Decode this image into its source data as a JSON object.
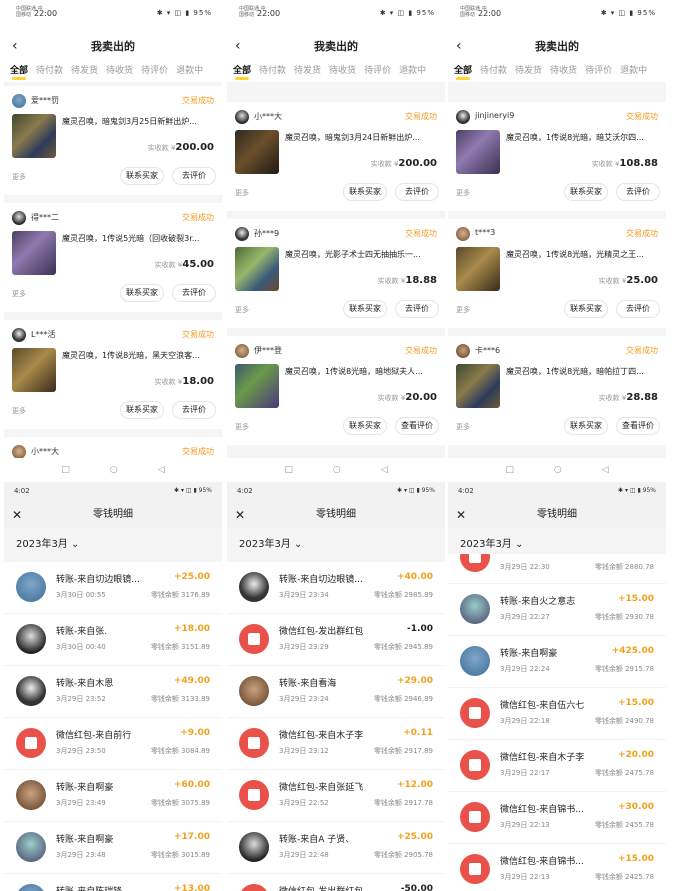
{
  "colors": {
    "accent": "#ffd330",
    "status": "#f49a1b",
    "income": "#f0a21c",
    "redpacket": "#e9524a"
  },
  "orders_common": {
    "title": "我卖出的",
    "tabs": [
      "全部",
      "待付款",
      "待发货",
      "待收货",
      "待评价",
      "退款中"
    ],
    "price_label": "实收款",
    "more": "更多",
    "contact_btn": "联系买家",
    "status": "交易成功",
    "back_icon": "chevron-left-icon"
  },
  "screens": [
    {
      "status_bar": {
        "carrier": "中国联通 中国移动",
        "time": "22:00",
        "icons": "✱ ▾ ◫ ▮ 95%"
      },
      "orders": [
        {
          "user": "爱***罚",
          "title": "魔灵召唤，暗鬼剑3月25日新鲜出炉...",
          "price_sym": "¥",
          "price": "200.00",
          "review": "去评价"
        },
        {
          "user": "得***二",
          "title": "魔灵召唤，1传说5光暗（回收破裂3r...",
          "price_sym": "¥",
          "price": "45.00",
          "review": "去评价"
        },
        {
          "user": "L***活",
          "title": "魔灵召唤，1传说8光暗，黑天空浪客...",
          "price_sym": "¥",
          "price": "18.00",
          "review": "去评价"
        },
        {
          "user": "小***大"
        }
      ],
      "wallet": {
        "time": "4:02",
        "title": "零钱明细",
        "month": "2023年3月",
        "rows": [
          {
            "name": "转账-来自切边眼镜...",
            "date": "3月30日 00:55",
            "amount": "+25.00",
            "bal": "零钱余额 3176.89",
            "type": "img"
          },
          {
            "name": "转账-来自张.",
            "date": "3月30日 00:40",
            "amount": "+18.00",
            "bal": "零钱余额 3151.89",
            "type": "img"
          },
          {
            "name": "转账-来自木恩",
            "date": "3月29日 23:52",
            "amount": "+49.00",
            "bal": "零钱余额 3133.89",
            "type": "img"
          },
          {
            "name": "微信红包-来自前行",
            "date": "3月29日 23:50",
            "amount": "+9.00",
            "bal": "零钱余额 3084.89",
            "type": "red"
          },
          {
            "name": "转账-来自啊豪",
            "date": "3月29日 23:49",
            "amount": "+60.00",
            "bal": "零钱余额 3075.89",
            "type": "img"
          },
          {
            "name": "转账-来自啊豪",
            "date": "3月29日 23:48",
            "amount": "+17.00",
            "bal": "零钱余额 3015.89",
            "type": "img"
          },
          {
            "name": "转账-来自陈瑞锋",
            "date": "",
            "amount": "+13.00",
            "bal": "",
            "type": "img"
          }
        ]
      }
    },
    {
      "status_bar": {
        "carrier": "中国联通 中国移动",
        "time": "22:00",
        "icons": "✱ ▾ ◫ ▮ 95%"
      },
      "orders": [
        {
          "user": "小***大",
          "title": "魔灵召唤，暗鬼剑3月24日新鲜出炉...",
          "price_sym": "¥",
          "price": "200.00",
          "review": "去评价"
        },
        {
          "user": "孙***9",
          "title": "魔灵召唤，光影子术士四无抽抽乐一...",
          "price_sym": "¥",
          "price": "18.88",
          "review": "去评价"
        },
        {
          "user": "伊***登",
          "title": "魔灵召唤，1传说8光暗，暗地狱夫人...",
          "price_sym": "¥",
          "price": "20.00",
          "review": "查看评价"
        }
      ],
      "wallet": {
        "time": "4:02",
        "title": "零钱明细",
        "month": "2023年3月",
        "rows": [
          {
            "name": "转账-来自切边眼镜...",
            "date": "3月29日 23:34",
            "amount": "+40.00",
            "bal": "零钱余额 2985.89",
            "type": "img"
          },
          {
            "name": "微信红包-发出群红包",
            "date": "3月29日 23:29",
            "amount": "-1.00",
            "bal": "零钱余额 2945.89",
            "type": "red"
          },
          {
            "name": "转账-来自看海",
            "date": "3月29日 23:24",
            "amount": "+29.00",
            "bal": "零钱余额 2946.89",
            "type": "img"
          },
          {
            "name": "微信红包-来自木子李",
            "date": "3月29日 23:12",
            "amount": "+0.11",
            "bal": "零钱余额 2917.89",
            "type": "red"
          },
          {
            "name": "微信红包-来自张延飞",
            "date": "3月29日 22:52",
            "amount": "+12.00",
            "bal": "零钱余额 2917.78",
            "type": "red"
          },
          {
            "name": "转账-来自A 子贤、",
            "date": "3月29日 22:48",
            "amount": "+25.00",
            "bal": "零钱余额 2905.78",
            "type": "img"
          },
          {
            "name": "微信红包-发出群红包",
            "date": "3月29日 22:30",
            "amount": "-50.00",
            "bal": "零钱余额 2880.78",
            "type": "red"
          }
        ]
      }
    },
    {
      "status_bar": {
        "carrier": "中国联通 中国移动",
        "time": "22:00",
        "icons": "✱ ▾ ◫ ▮ 95%"
      },
      "orders": [
        {
          "user": "jinjineryi9",
          "title": "魔灵召唤，1传说8光暗，暗艾沃尔四...",
          "price_sym": "¥",
          "price": "108.88",
          "review": "去评价"
        },
        {
          "user": "t***3",
          "title": "魔灵召唤，1传说8光暗，光精灵之王...",
          "price_sym": "¥",
          "price": "25.00",
          "review": "去评价"
        },
        {
          "user": "卡***6",
          "title": "魔灵召唤，1传说8光暗，暗帕拉丁四...",
          "price_sym": "¥",
          "price": "28.88",
          "review": "查看评价"
        }
      ],
      "wallet": {
        "time": "4:02",
        "title": "零钱明细",
        "month": "2023年3月",
        "rows": [
          {
            "name": "",
            "date": "3月29日 22:30",
            "amount": "",
            "bal": "零钱余额 2880.78",
            "type": "red",
            "partial": true
          },
          {
            "name": "转账-来自火之意志",
            "date": "3月29日 22:27",
            "amount": "+15.00",
            "bal": "零钱余额 2930.78",
            "type": "img"
          },
          {
            "name": "转账-来自啊豪",
            "date": "3月29日 22:24",
            "amount": "+425.00",
            "bal": "零钱余额 2915.78",
            "type": "img"
          },
          {
            "name": "微信红包-来自伍六七",
            "date": "3月29日 22:18",
            "amount": "+15.00",
            "bal": "零钱余额 2490.78",
            "type": "red"
          },
          {
            "name": "微信红包-来自木子李",
            "date": "3月29日 22:17",
            "amount": "+20.00",
            "bal": "零钱余额 2475.78",
            "type": "red"
          },
          {
            "name": "微信红包-来自锦书...",
            "date": "3月29日 22:13",
            "amount": "+30.00",
            "bal": "零钱余额 2455.78",
            "type": "red"
          },
          {
            "name": "微信红包-来自锦书...",
            "date": "3月29日 22:13",
            "amount": "+15.00",
            "bal": "零钱余额 2425.78",
            "type": "red"
          }
        ]
      }
    }
  ]
}
